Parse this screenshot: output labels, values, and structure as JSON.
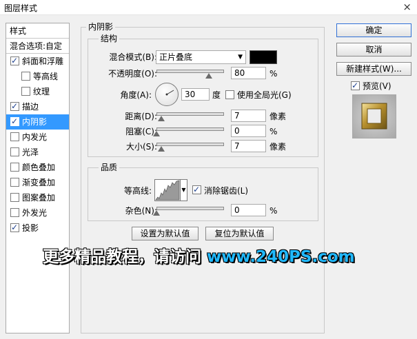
{
  "window": {
    "title": "图层样式",
    "close": "×"
  },
  "style_list": {
    "header": "样式",
    "blend_options": "混合选项:自定",
    "items": [
      {
        "label": "斜面和浮雕",
        "checked": true,
        "indent": false,
        "selected": false
      },
      {
        "label": "等高线",
        "checked": false,
        "indent": true,
        "selected": false
      },
      {
        "label": "纹理",
        "checked": false,
        "indent": true,
        "selected": false
      },
      {
        "label": "描边",
        "checked": true,
        "indent": false,
        "selected": false
      },
      {
        "label": "内阴影",
        "checked": true,
        "indent": false,
        "selected": true
      },
      {
        "label": "内发光",
        "checked": false,
        "indent": false,
        "selected": false
      },
      {
        "label": "光泽",
        "checked": false,
        "indent": false,
        "selected": false
      },
      {
        "label": "颜色叠加",
        "checked": false,
        "indent": false,
        "selected": false
      },
      {
        "label": "渐变叠加",
        "checked": false,
        "indent": false,
        "selected": false
      },
      {
        "label": "图案叠加",
        "checked": false,
        "indent": false,
        "selected": false
      },
      {
        "label": "外发光",
        "checked": false,
        "indent": false,
        "selected": false
      },
      {
        "label": "投影",
        "checked": true,
        "indent": false,
        "selected": false
      }
    ]
  },
  "panel": {
    "title": "内阴影",
    "structure": {
      "title": "结构",
      "blend_mode_label": "混合模式(B):",
      "blend_mode_value": "正片叠底",
      "color": "#000000",
      "opacity_label": "不透明度(O):",
      "opacity_value": "80",
      "opacity_unit": "%",
      "angle_label": "角度(A):",
      "angle_value": "30",
      "angle_unit": "度",
      "global_light_label": "使用全局光(G)",
      "global_light_checked": false,
      "distance_label": "距离(D):",
      "distance_value": "7",
      "distance_unit": "像素",
      "choke_label": "阻塞(C):",
      "choke_value": "0",
      "choke_unit": "%",
      "size_label": "大小(S):",
      "size_value": "7",
      "size_unit": "像素"
    },
    "quality": {
      "title": "品质",
      "contour_label": "等高线:",
      "antialias_label": "消除锯齿(L)",
      "antialias_checked": true,
      "noise_label": "杂色(N):",
      "noise_value": "0",
      "noise_unit": "%"
    },
    "buttons": {
      "set_default": "设置为默认值",
      "reset_default": "复位为默认值"
    }
  },
  "right": {
    "ok": "确定",
    "cancel": "取消",
    "new_style": "新建样式(W)...",
    "preview_label": "预览(V)",
    "preview_checked": true
  },
  "watermark": {
    "text_cn": "更多精品教程，请访问",
    "url": "www.240PS.com"
  }
}
